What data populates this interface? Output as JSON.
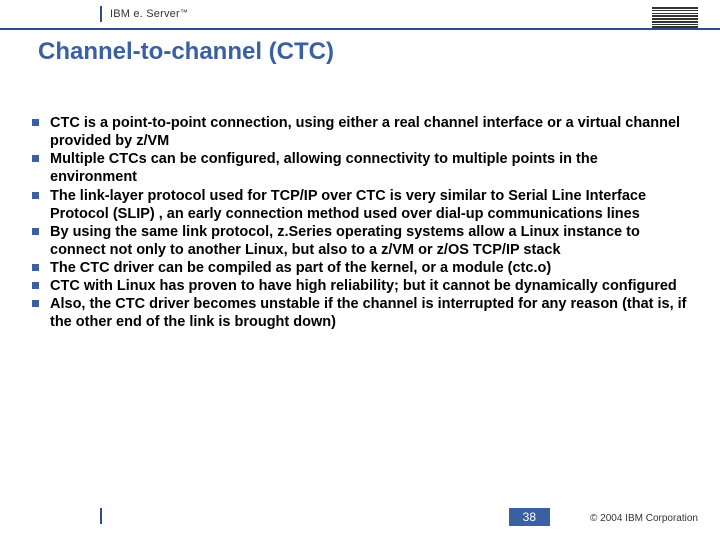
{
  "header": {
    "brand_prefix": "IBM e. Server",
    "brand_tm": "™"
  },
  "title": "Channel-to-channel (CTC)",
  "bullets": [
    "CTC is a point-to-point connection, using either a real channel interface or a virtual channel provided by z/VM",
    "Multiple CTCs can be configured, allowing connectivity to multiple points in the environment",
    "The link-layer protocol used for TCP/IP over CTC is very similar to Serial Line Interface Protocol (SLIP) , an early connection method used over dial-up communications lines",
    "By using the same link protocol, z.Series operating systems allow a Linux instance to connect not only to another Linux, but also to a z/VM or z/OS TCP/IP stack",
    "The CTC driver can be compiled as part of the kernel, or a module (ctc.o)",
    "CTC with Linux has proven to have high reliability; but it cannot be dynamically configured",
    "Also, the CTC driver becomes unstable if the channel is interrupted for any reason (that is, if the other end of the link is brought down)"
  ],
  "footer": {
    "page_number": "38",
    "copyright": "© 2004 IBM Corporation"
  }
}
